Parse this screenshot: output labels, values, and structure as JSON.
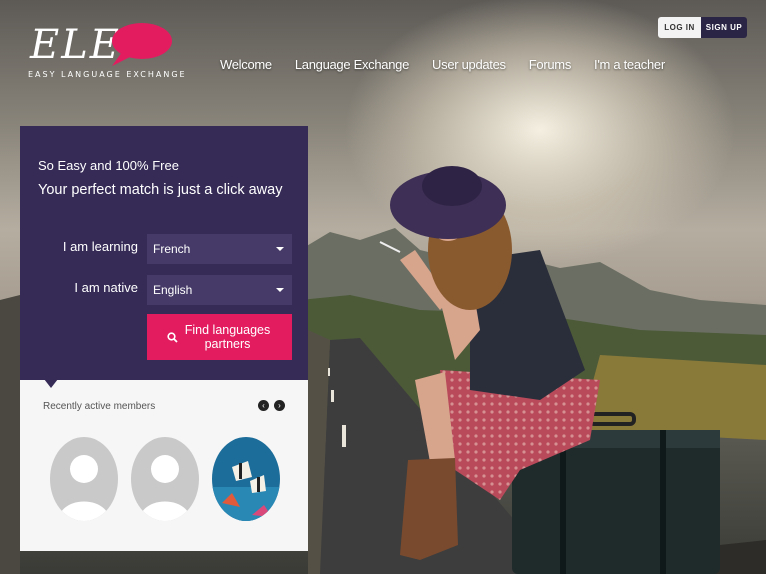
{
  "logo": {
    "text": "ELE",
    "tagline": "EASY LANGUAGE EXCHANGE"
  },
  "nav": {
    "items": [
      "Welcome",
      "Language Exchange",
      "User updates",
      "Forums",
      "I'm a teacher"
    ]
  },
  "auth": {
    "login": "LOG IN",
    "signup": "SIGN UP"
  },
  "search": {
    "headline_1": "So Easy and 100% Free",
    "headline_2": "Your perfect match is just a click away",
    "learning_label": "I am learning",
    "learning_value": "French",
    "native_label": "I am native",
    "native_value": "English",
    "find_button": "Find languages partners"
  },
  "members": {
    "title": "Recently active members",
    "prev": "‹",
    "next": "›"
  },
  "colors": {
    "panel": "#362b57",
    "accent": "#e31c60",
    "signup": "#2b2545"
  }
}
